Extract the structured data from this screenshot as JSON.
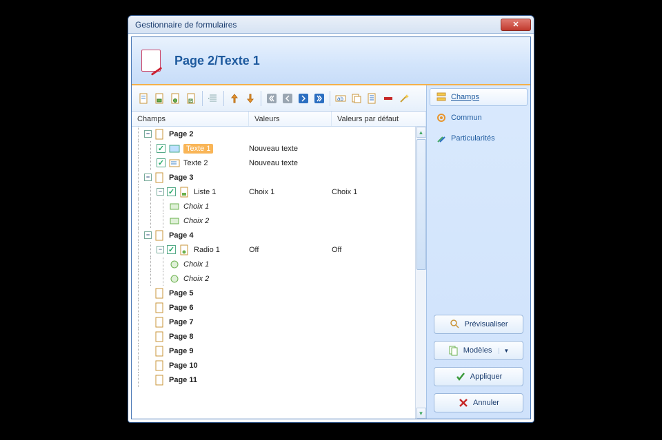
{
  "window": {
    "title": "Gestionnaire de formulaires"
  },
  "header": {
    "title": "Page 2/Texte 1"
  },
  "columns": {
    "c1": "Champs",
    "c2": "Valeurs",
    "c3": "Valeurs par défaut"
  },
  "side": {
    "champs": "Champs",
    "commun": "Commun",
    "particularites": "Particularités"
  },
  "buttons": {
    "preview": "Prévisualiser",
    "templates": "Modèles",
    "apply": "Appliquer",
    "cancel": "Annuler"
  },
  "tree": {
    "page2": "Page 2",
    "texte1": "Texte 1",
    "texte1_val": "Nouveau texte",
    "texte2": "Texte 2",
    "texte2_val": "Nouveau texte",
    "page3": "Page 3",
    "liste1": "Liste 1",
    "liste1_val": "Choix 1",
    "liste1_def": "Choix 1",
    "choix1": "Choix 1",
    "choix2": "Choix 2",
    "page4": "Page 4",
    "radio1": "Radio 1",
    "radio1_val": "Off",
    "radio1_def": "Off",
    "page5": "Page 5",
    "page6": "Page 6",
    "page7": "Page 7",
    "page8": "Page 8",
    "page9": "Page 9",
    "page10": "Page 10",
    "page11": "Page 11"
  },
  "toolbar_icons": [
    "page-text",
    "page-combo",
    "page-radio",
    "page-check",
    "indent",
    "arrow-up-orange",
    "arrow-down-orange",
    "nav-first",
    "nav-prev",
    "nav-next",
    "nav-last",
    "field-text",
    "field-copy",
    "field-list",
    "delete-red",
    "wand"
  ]
}
